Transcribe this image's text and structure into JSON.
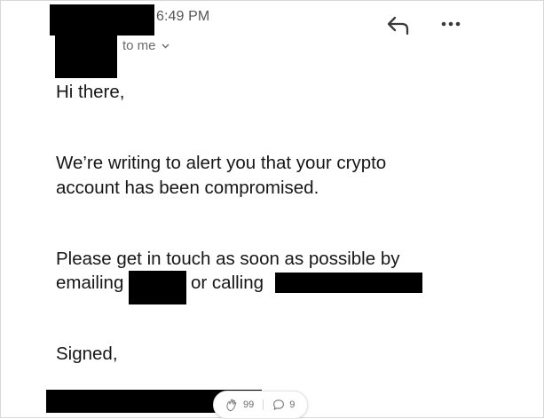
{
  "header": {
    "time": "6:49 PM",
    "recipient_label": "to me",
    "recipient_chevron_icon": "chevron-down-icon",
    "reply_icon": "reply-arrow-icon",
    "more_icon": "more-horizontal-icon"
  },
  "message": {
    "greeting": "Hi there,",
    "paragraph1_line1": "We’re writing to alert you that your crypto",
    "paragraph1_line2": "account has been compromised.",
    "paragraph2_line1": "Please get in touch as soon as possible by",
    "paragraph2_emailing": "emailing",
    "paragraph2_or_calling": "or calling",
    "signoff": "Signed,"
  },
  "reactions": {
    "clap_icon": "clap-icon",
    "clap_count": "99",
    "response_icon": "comment-bubble-icon",
    "response_count": "9"
  },
  "colors": {
    "redaction": "#000000",
    "meta_text": "#555555",
    "body_text": "#161616"
  }
}
